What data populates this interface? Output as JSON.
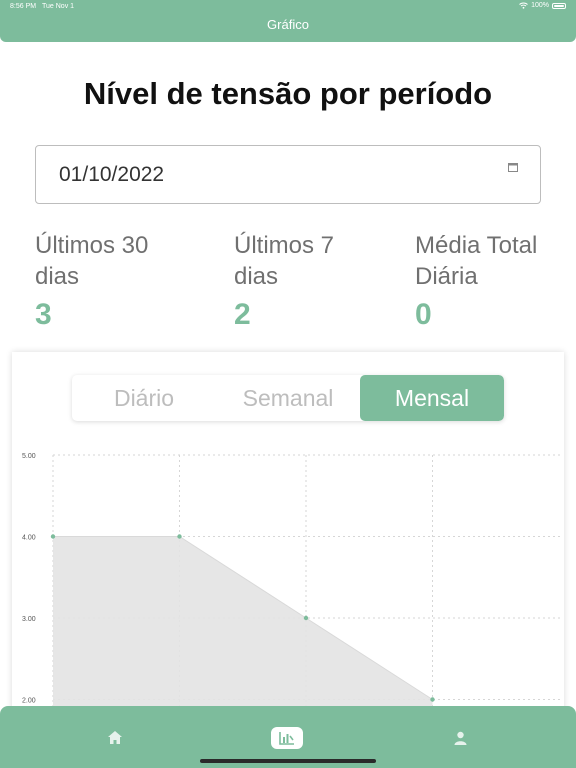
{
  "status_bar": {
    "time": "8:56 PM",
    "date": "Tue Nov 1",
    "battery": "100%"
  },
  "header": {
    "title": "Gráfico"
  },
  "page": {
    "title": "Nível de tensão por período"
  },
  "date_field": {
    "value": "01/10/2022"
  },
  "stats": [
    {
      "label_line1": "Últimos 30",
      "label_line2": "dias",
      "value": "3"
    },
    {
      "label_line1": "Últimos 7",
      "label_line2": "dias",
      "value": "2"
    },
    {
      "label_line1": "Média Total",
      "label_line2": "Diária",
      "value": "0"
    }
  ],
  "segments": [
    {
      "label": "Diário",
      "active": false
    },
    {
      "label": "Semanal",
      "active": false
    },
    {
      "label": "Mensal",
      "active": true
    }
  ],
  "chart_data": {
    "type": "area",
    "x": [
      1,
      2,
      3,
      4
    ],
    "values": [
      4.0,
      4.0,
      3.0,
      2.0
    ],
    "y_ticks": [
      "5.00",
      "4.00",
      "3.00",
      "2.00"
    ],
    "ylim": [
      2.0,
      5.0
    ],
    "grid": true,
    "fill_color": "#e3e3e3",
    "point_color": "#7dbc9c"
  },
  "tabbar": {
    "items": [
      {
        "icon": "home-icon",
        "active": false
      },
      {
        "icon": "chart-icon",
        "active": true
      },
      {
        "icon": "person-icon",
        "active": false
      }
    ]
  },
  "colors": {
    "accent": "#7dbc9c",
    "muted_text": "#707070"
  }
}
